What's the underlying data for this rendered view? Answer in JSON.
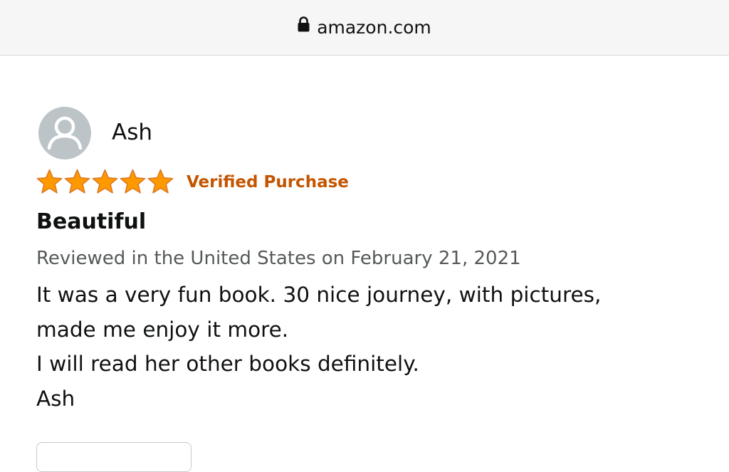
{
  "browser": {
    "url": "amazon.com",
    "lock_icon": "lock-icon"
  },
  "review": {
    "reviewer_name": "Ash",
    "avatar_icon": "person-icon",
    "rating": 5,
    "rating_max": 5,
    "star_color": "#ff9900",
    "verified_label": "Verified Purchase",
    "verified_color": "#c45500",
    "title": "Beautiful",
    "meta": "Reviewed in the United States on February 21, 2021",
    "body_lines": [
      "It was a very fun book. 30 nice journey, with pictures,",
      "made me enjoy it more.",
      "I will read her other books definitely.",
      "Ash"
    ]
  }
}
